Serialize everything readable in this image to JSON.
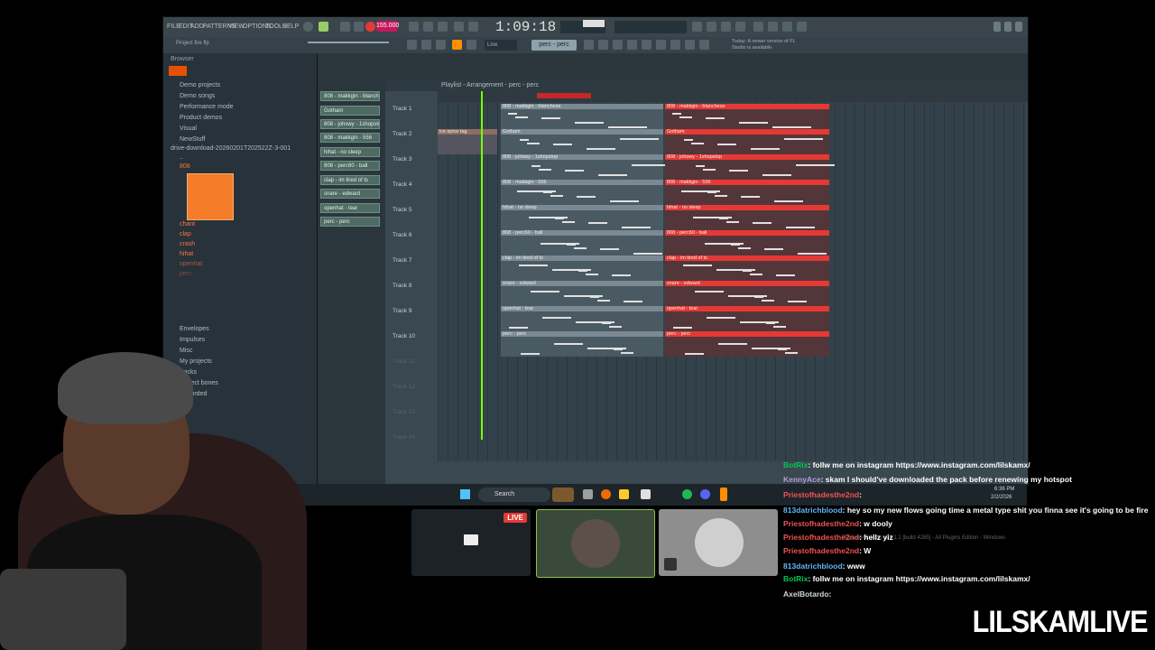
{
  "fl": {
    "menus": [
      "FILE",
      "EDIT",
      "ADD",
      "PATTERNS",
      "VIEW",
      "OPTIONS",
      "TOOLS",
      "HELP"
    ],
    "tempo": "155.000",
    "timecode": "1:09:18",
    "hint": "Today: A newer version of FL Studio is available",
    "pattern": "perc - perc",
    "project_title": "Project fire flp",
    "edition_text": "Producer Edition v24.1.1 [build 4285] - All Plugins Edition - Windows"
  },
  "browser": {
    "header": "Browser",
    "items": [
      "Demo projects",
      "Demo songs",
      "Performance mode",
      "Product demos",
      "Visual",
      "NewStuff",
      "drive-download-20260201T202522Z-3-001",
      "..",
      "808"
    ],
    "files": [
      "chant",
      "clap",
      "crash",
      "hihat",
      "openhat",
      "perc"
    ],
    "folders": [
      "Envelopes",
      "Impulses",
      "Misc",
      "My projects",
      "Packs",
      "Project bones",
      "Recorded"
    ]
  },
  "channels": [
    "808 - makkgin - blanchese",
    "Gotham",
    "808 - johswy - 1shopstop",
    "808 - makkgin - 556",
    "hihat - no sleep",
    "808 - perc60 - ball",
    "clap - im tired of ts",
    "snare - edward",
    "openhat - tear",
    "perc - perc"
  ],
  "playlist": {
    "breadcrumb": "Playlist - Arrangement - perc - perc",
    "tracks": [
      "Track 1",
      "Track 2",
      "Track 3",
      "Track 4",
      "Track 5",
      "Track 6",
      "Track 7",
      "Track 8",
      "Track 9",
      "Track 10",
      "Track 11",
      "Track 12",
      "Track 13",
      "Track 14"
    ],
    "audio_clip": "ice spice tag",
    "clips": [
      {
        "grey": "808 - makkgin - blanchese",
        "red": "808 - makkgin - blanchese"
      },
      {
        "grey": "Gotham",
        "red": "Gotham"
      },
      {
        "grey": "808 - johswy - 1shopstop",
        "red": "808 - johswy - 1shopstop"
      },
      {
        "grey": "808 - makkgin - 556",
        "red": "808 - makkgin - 556"
      },
      {
        "grey": "hihat - no sleep",
        "red": "hihat - no sleep"
      },
      {
        "grey": "808 - perc60 - ball",
        "red": "808 - perc60 - ball"
      },
      {
        "grey": "clap - im tired of ts",
        "red": "clap - im tired of ts"
      },
      {
        "grey": "snare - edward",
        "red": "snare - edward"
      },
      {
        "grey": "openhat - tear",
        "red": "openhat - tear"
      },
      {
        "grey": "perc - perc",
        "red": "perc - perc"
      }
    ]
  },
  "taskbar": {
    "search": "Search",
    "time": "6:36 PM",
    "date": "2/2/2026"
  },
  "stream": {
    "live": "LIVE",
    "brand": "LILSKAMLIVE"
  },
  "chat": [
    {
      "user": "BotRix",
      "text": ": follw me on instagram https://www.instagram.com/lilskamx/",
      "color": "green"
    },
    {
      "user": "KennyAce",
      "text": ": skam I should've downloaded the pack before renewing my hotspot",
      "color": "purple"
    },
    {
      "user": "Priestofhadesthe2nd",
      "text": ":",
      "color": "red"
    },
    {
      "user": "813datrichblood",
      "text": ": hey so my new flows going time a metal type shit you finna see it's going to be fire",
      "color": "blue"
    },
    {
      "user": "Priestofhadesthe2nd",
      "text": ": w dooly",
      "color": "red"
    },
    {
      "user": "Priestofhadesthe2nd",
      "text": ": hellz yiz",
      "color": "red"
    },
    {
      "user": "Priestofhadesthe2nd",
      "text": ": W",
      "color": "red"
    },
    {
      "user": "813datrichblood",
      "text": ": www",
      "color": "blue"
    },
    {
      "user": "BotRix",
      "text": ": follw me on instagram https://www.instagram.com/lilskamx/",
      "color": "green"
    },
    {
      "user": "AxelBotardo",
      "text": ":",
      "color": "grey"
    }
  ],
  "colors": {
    "accent": "#e53935",
    "fl_bg": "#2b363c",
    "green_playhead": "#76ff03",
    "orange": "#f57c28"
  }
}
